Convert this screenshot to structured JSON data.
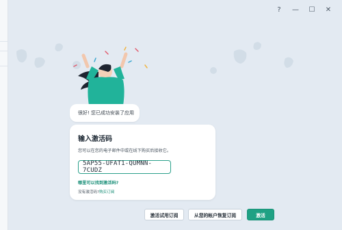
{
  "window": {
    "controls": {
      "help": "?",
      "minimize": "—",
      "maximize": "☐",
      "close": "✕"
    }
  },
  "greeting": {
    "text": "很好! 您已成功安装了应用"
  },
  "activation": {
    "title": "输入激活码",
    "subtitle": "您可以在您的电子邮件中或在线下购买后接收它。",
    "key_value": "5AP55-UFAT1-QUMNN-7CUDZ",
    "help_link": "哪里可以找到激活码?",
    "no_code_prefix": "没有激活码?",
    "no_code_link": "购买订阅"
  },
  "footer": {
    "trial_button": "激活试用订阅",
    "restore_button": "从您的帐户恢复订阅",
    "activate_button": "激活"
  },
  "colors": {
    "accent": "#1fa184",
    "background": "#e3eaf2",
    "card": "#ffffff"
  }
}
